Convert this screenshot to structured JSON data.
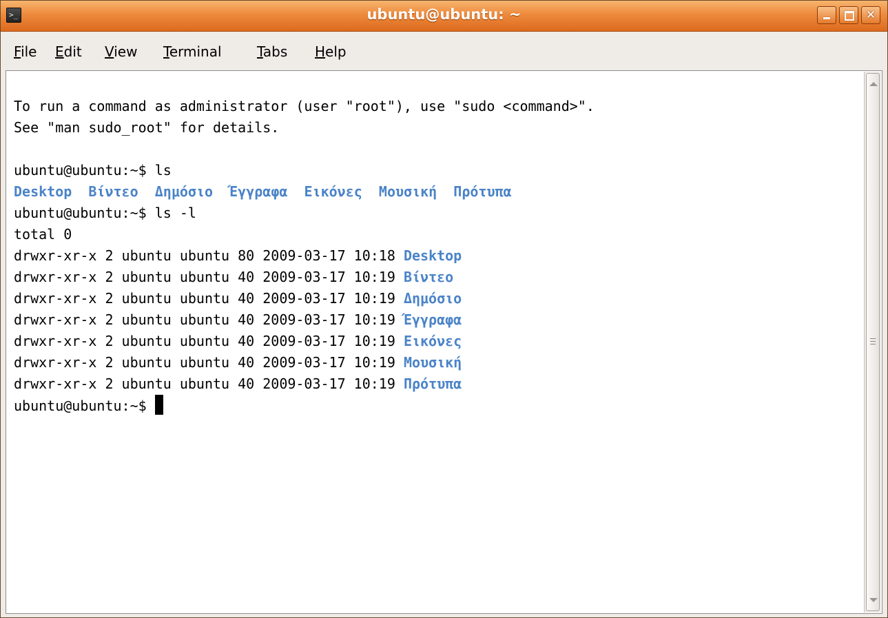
{
  "window": {
    "title": "ubuntu@ubuntu: ~",
    "controls": {
      "minimize": "minimize",
      "maximize": "maximize",
      "close": "close"
    }
  },
  "menubar": {
    "items": [
      {
        "mnemonic": "F",
        "rest": "ile"
      },
      {
        "mnemonic": "E",
        "rest": "dit"
      },
      {
        "mnemonic": "V",
        "rest": "iew"
      },
      {
        "mnemonic": "T",
        "rest": "erminal"
      },
      {
        "mnemonic": "T",
        "rest": "abs"
      },
      {
        "mnemonic": "H",
        "rest": "elp"
      }
    ]
  },
  "terminal": {
    "lines": [
      "To run a command as administrator (user \"root\"), use \"sudo <command>\".",
      "See \"man sudo_root\" for details.",
      "",
      "ubuntu@ubuntu:~$ ls"
    ],
    "ls_dirs": [
      "Desktop",
      "Βίντεο",
      "Δημόσιο",
      "Έγγραφα",
      "Εικόνες",
      "Μουσική",
      "Πρότυπα"
    ],
    "cmd2": "ubuntu@ubuntu:~$ ls -l",
    "total": "total 0",
    "long_rows": [
      {
        "perm": "drwxr-xr-x 2 ubuntu ubuntu 80 2009-03-17 10:18",
        "name": "Desktop"
      },
      {
        "perm": "drwxr-xr-x 2 ubuntu ubuntu 40 2009-03-17 10:19",
        "name": "Βίντεο"
      },
      {
        "perm": "drwxr-xr-x 2 ubuntu ubuntu 40 2009-03-17 10:19",
        "name": "Δημόσιο"
      },
      {
        "perm": "drwxr-xr-x 2 ubuntu ubuntu 40 2009-03-17 10:19",
        "name": "Έγγραφα"
      },
      {
        "perm": "drwxr-xr-x 2 ubuntu ubuntu 40 2009-03-17 10:19",
        "name": "Εικόνες"
      },
      {
        "perm": "drwxr-xr-x 2 ubuntu ubuntu 40 2009-03-17 10:19",
        "name": "Μουσική"
      },
      {
        "perm": "drwxr-xr-x 2 ubuntu ubuntu 40 2009-03-17 10:19",
        "name": "Πρότυπα"
      }
    ],
    "prompt": "ubuntu@ubuntu:~$ "
  },
  "colors": {
    "titlebar": "#ee8a3c",
    "directory": "#4a83c8",
    "terminal_bg": "#ffffff",
    "chrome_bg": "#efebe7"
  },
  "icons": [
    "terminal-icon",
    "minimize-icon",
    "maximize-icon",
    "close-icon",
    "scroll-up-arrow-icon",
    "scroll-down-arrow-icon",
    "scroll-grip-icon"
  ]
}
